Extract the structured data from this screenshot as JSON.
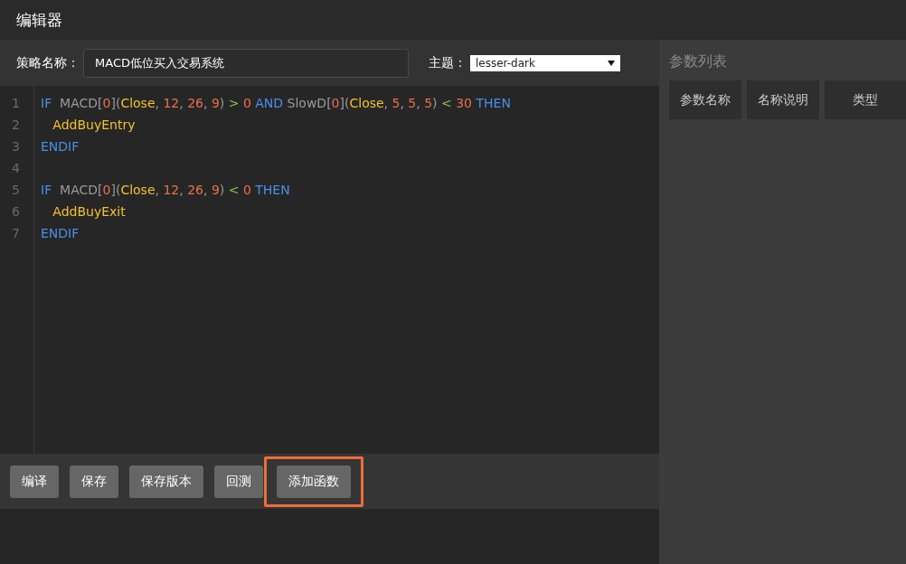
{
  "window": {
    "title": "编辑器"
  },
  "strategy": {
    "label": "策略名称：",
    "value": "MACD低位买入交易系统"
  },
  "theme": {
    "label": "主题：",
    "value": "lesser-dark"
  },
  "code_lines": [
    {
      "number": "1",
      "tokens": [
        {
          "kind": "kw",
          "text": "IF"
        },
        {
          "kind": "fn",
          "text": "  MACD["
        },
        {
          "kind": "num",
          "text": "0"
        },
        {
          "kind": "fn",
          "text": "]("
        },
        {
          "kind": "var",
          "text": "Close"
        },
        {
          "kind": "fn",
          "text": ", "
        },
        {
          "kind": "num",
          "text": "12"
        },
        {
          "kind": "fn",
          "text": ", "
        },
        {
          "kind": "num",
          "text": "26"
        },
        {
          "kind": "fn",
          "text": ", "
        },
        {
          "kind": "num",
          "text": "9"
        },
        {
          "kind": "fn",
          "text": ") "
        },
        {
          "kind": "op",
          "text": "> "
        },
        {
          "kind": "num",
          "text": "0 "
        },
        {
          "kind": "kw",
          "text": "AND"
        },
        {
          "kind": "fn",
          "text": " SlowD["
        },
        {
          "kind": "num",
          "text": "0"
        },
        {
          "kind": "fn",
          "text": "]("
        },
        {
          "kind": "var",
          "text": "Close"
        },
        {
          "kind": "fn",
          "text": ", "
        },
        {
          "kind": "num",
          "text": "5"
        },
        {
          "kind": "fn",
          "text": ", "
        },
        {
          "kind": "num",
          "text": "5"
        },
        {
          "kind": "fn",
          "text": ", "
        },
        {
          "kind": "num",
          "text": "5"
        },
        {
          "kind": "fn",
          "text": ") "
        },
        {
          "kind": "op",
          "text": "< "
        },
        {
          "kind": "num",
          "text": "30 "
        },
        {
          "kind": "kw",
          "text": "THEN"
        }
      ]
    },
    {
      "number": "2",
      "tokens": [
        {
          "kind": "var",
          "text": "   AddBuyEntry"
        }
      ]
    },
    {
      "number": "3",
      "tokens": [
        {
          "kind": "kw",
          "text": "ENDIF"
        }
      ]
    },
    {
      "number": "4"
    },
    {
      "number": "5",
      "tokens": [
        {
          "kind": "kw",
          "text": "IF"
        },
        {
          "kind": "fn",
          "text": "  MACD["
        },
        {
          "kind": "num",
          "text": "0"
        },
        {
          "kind": "fn",
          "text": "]("
        },
        {
          "kind": "var",
          "text": "Close"
        },
        {
          "kind": "fn",
          "text": ", "
        },
        {
          "kind": "num",
          "text": "12"
        },
        {
          "kind": "fn",
          "text": ", "
        },
        {
          "kind": "num",
          "text": "26"
        },
        {
          "kind": "fn",
          "text": ", "
        },
        {
          "kind": "num",
          "text": "9"
        },
        {
          "kind": "fn",
          "text": ") "
        },
        {
          "kind": "op",
          "text": "< "
        },
        {
          "kind": "num",
          "text": "0 "
        },
        {
          "kind": "kw",
          "text": "THEN"
        }
      ]
    },
    {
      "number": "6",
      "tokens": [
        {
          "kind": "var",
          "text": "   AddBuyExit"
        }
      ]
    },
    {
      "number": "7",
      "tokens": [
        {
          "kind": "kw",
          "text": "ENDIF"
        }
      ]
    }
  ],
  "buttons": [
    {
      "label": "编译",
      "highlighted": false
    },
    {
      "label": "保存",
      "highlighted": false
    },
    {
      "label": "保存版本",
      "highlighted": false
    },
    {
      "label": "回测",
      "highlighted": false
    },
    {
      "label": "添加函数",
      "highlighted": true
    }
  ],
  "params": {
    "title": "参数列表",
    "columns": [
      "参数名称",
      "名称说明",
      "类型"
    ]
  }
}
